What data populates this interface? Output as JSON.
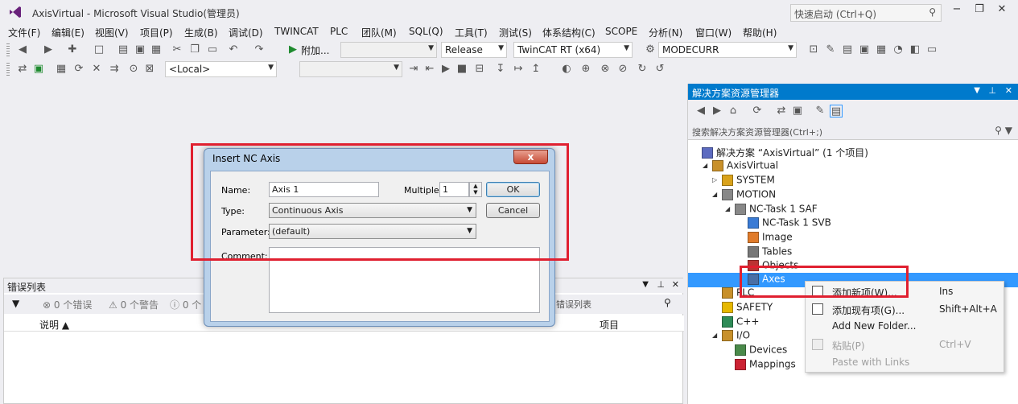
{
  "window": {
    "title": "AxisVirtual - Microsoft Visual Studio(管理员)",
    "quick_launch_placeholder": "快速启动 (Ctrl+Q)",
    "min": "−",
    "restore": "❐",
    "close": "✕"
  },
  "menu": [
    "文件(F)",
    "编辑(E)",
    "视图(V)",
    "项目(P)",
    "生成(B)",
    "调试(D)",
    "TWINCAT",
    "PLC",
    "团队(M)",
    "SQL(Q)",
    "工具(T)",
    "测试(S)",
    "体系结构(C)",
    "SCOPE",
    "分析(N)",
    "窗口(W)",
    "帮助(H)"
  ],
  "toolbar1": {
    "attach_label": "附加...",
    "config_combo": "Release",
    "platform_combo": "TwinCAT RT (x64)",
    "target_combo": "MODECURR"
  },
  "toolbar2": {
    "local_combo": "<Local>"
  },
  "dialog": {
    "title": "Insert NC Axis",
    "close_label": "x",
    "name_label": "Name:",
    "name_value": "Axis 1",
    "multiple_label": "Multiple:",
    "multiple_value": "1",
    "ok_label": "OK",
    "cancel_label": "Cancel",
    "type_label": "Type:",
    "type_value": "Continuous Axis",
    "parameter_label": "Parameter:",
    "parameter_value": "(default)",
    "comment_label": "Comment:"
  },
  "error_list": {
    "title": "错误列表",
    "errors": "0 个错误",
    "warnings": "0 个警告",
    "messages": "0 个",
    "search_placeholder": "错误列表",
    "col_description": "说明",
    "col_project": "项目"
  },
  "solution_explorer": {
    "title": "解决方案资源管理器",
    "search_placeholder": "搜索解决方案资源管理器(Ctrl+;)",
    "tree": [
      {
        "label": "解决方案 “AxisVirtual” (1 个项目)",
        "level": 0,
        "twisty": "",
        "icon": "solution"
      },
      {
        "label": "AxisVirtual",
        "level": 1,
        "twisty": "◢",
        "icon": "project"
      },
      {
        "label": "SYSTEM",
        "level": 2,
        "twisty": "▷",
        "icon": "system"
      },
      {
        "label": "MOTION",
        "level": 2,
        "twisty": "◢",
        "icon": "motion"
      },
      {
        "label": "NC-Task 1 SAF",
        "level": 3,
        "twisty": "◢",
        "icon": "task"
      },
      {
        "label": "NC-Task 1 SVB",
        "level": 4,
        "twisty": "",
        "icon": "svb"
      },
      {
        "label": "Image",
        "level": 4,
        "twisty": "",
        "icon": "image"
      },
      {
        "label": "Tables",
        "level": 4,
        "twisty": "",
        "icon": "tables"
      },
      {
        "label": "Objects",
        "level": 4,
        "twisty": "",
        "icon": "objects"
      },
      {
        "label": "Axes",
        "level": 4,
        "twisty": "",
        "icon": "axes",
        "selected": true
      },
      {
        "label": "PLC",
        "level": 2,
        "twisty": "",
        "icon": "plc"
      },
      {
        "label": "SAFETY",
        "level": 2,
        "twisty": "",
        "icon": "safety"
      },
      {
        "label": "C++",
        "level": 2,
        "twisty": "",
        "icon": "cpp"
      },
      {
        "label": "I/O",
        "level": 2,
        "twisty": "◢",
        "icon": "io"
      },
      {
        "label": "Devices",
        "level": 3,
        "twisty": "",
        "icon": "devices"
      },
      {
        "label": "Mappings",
        "level": 3,
        "twisty": "",
        "icon": "mappings"
      }
    ]
  },
  "context_menu": [
    {
      "label": "添加新项(W)...",
      "shortcut": "Ins",
      "disabled": false,
      "icon": "new-item"
    },
    {
      "label": "添加现有项(G)...",
      "shortcut": "Shift+Alt+A",
      "disabled": false,
      "icon": "existing-item"
    },
    {
      "label": "Add New Folder...",
      "shortcut": "",
      "disabled": false,
      "icon": ""
    },
    {
      "label": "粘贴(P)",
      "shortcut": "Ctrl+V",
      "disabled": true,
      "icon": "paste"
    },
    {
      "label": "Paste with Links",
      "shortcut": "",
      "disabled": true,
      "icon": ""
    }
  ],
  "colors": {
    "accent": "#007acc",
    "highlight": "#e02030",
    "selection": "#3399ff"
  }
}
